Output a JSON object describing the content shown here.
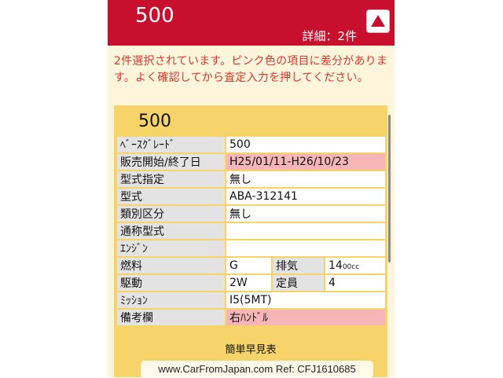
{
  "header": {
    "title": "500",
    "detail": "詳細：2件",
    "up_icon": "triangle-up-icon",
    "brand_color": "#c8102e"
  },
  "notice": "2件選択されています。ピンク色の項目に差分があります。よく確認してから査定入力を押してください。",
  "card": {
    "title": "500",
    "rows": {
      "base_grade": {
        "label": "ﾍﾞｰｽｸﾞﾚｰﾄﾞ",
        "value": "500"
      },
      "sales_period": {
        "label": "販売開始/終了日",
        "value": "H25/01/11-H26/10/23"
      },
      "type_designation": {
        "label": "型式指定",
        "value": "無し"
      },
      "model_code": {
        "label": "型式",
        "value": "ABA-312141"
      },
      "category_code": {
        "label": "類別区分",
        "value": "無し"
      },
      "common_model": {
        "label": "通称型式",
        "value": ""
      },
      "engine": {
        "label": "ｴﾝｼﾞﾝ",
        "value": ""
      },
      "fuel": {
        "label": "燃料",
        "value": "G"
      },
      "displacement": {
        "label": "排気",
        "value": "14",
        "unit": "00cc"
      },
      "drive": {
        "label": "駆動",
        "value": "2W"
      },
      "capacity": {
        "label": "定員",
        "value": "4"
      },
      "transmission": {
        "label": "ﾐｯｼｮﾝ",
        "value": "I5(5MT)"
      },
      "remarks": {
        "label": "備考欄",
        "value": "右ﾊﾝﾄﾞﾙ"
      }
    },
    "quick_link": "簡単早見表"
  },
  "watermark": "www.CarFromJapan.com Ref: CFJ1610685",
  "colors": {
    "diff_highlight": "#f6b6b8",
    "card_background": "#f6d46a",
    "notice_text": "#e0362b"
  }
}
